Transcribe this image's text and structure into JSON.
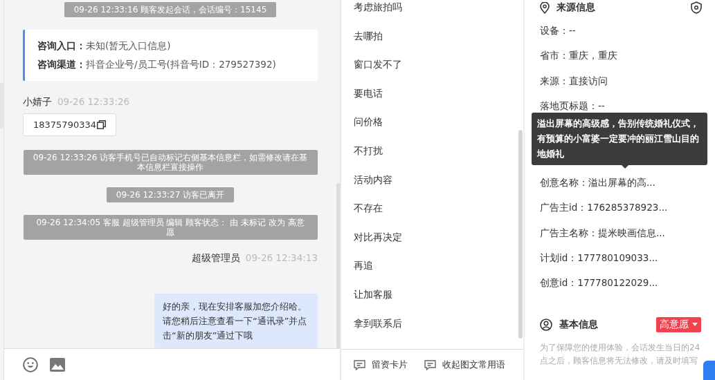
{
  "chat": {
    "messages": [
      {
        "kind": "notice",
        "text": "09-26 12:33:16 顾客发起会话，会话编号：15145"
      },
      {
        "kind": "entry",
        "rows": [
          {
            "label": "咨询入口：",
            "value": "未知(暂无入口信息)"
          },
          {
            "label": "咨询渠道：",
            "value": "抖音企业号/员工号(抖音号ID：279527392)"
          }
        ]
      },
      {
        "kind": "incoming",
        "sender": "小婧子",
        "time": "09-26 12:33:26",
        "text": "18375790334"
      },
      {
        "kind": "notice",
        "text": "09-26 12:33:26 访客手机号已自动标记右侧基本信息栏，如需修改请在基本信息栏直接操作"
      },
      {
        "kind": "notice",
        "text": "09-26 12:33:27 访客已离开"
      },
      {
        "kind": "notice",
        "text": "09-26 12:34:05 客服 超级管理员 编辑 顾客状态： 由 未标记 改为 高意愿"
      },
      {
        "kind": "outgoing",
        "sender": "超级管理员",
        "time": "09-26 12:34:13",
        "text": "好的亲，现在安排客服加您介绍哈。请您稍后注意查看一下“通讯录”并点击“新的朋友”通过下哦"
      }
    ]
  },
  "quick_replies": {
    "items": [
      "考虑旅拍吗",
      "去哪拍",
      "窗口发不了",
      "要电话",
      "问价格",
      "不打扰",
      "活动内容",
      "不存在",
      "对比再决定",
      "再追",
      "让加客服",
      "拿到联系后"
    ],
    "actions": [
      {
        "label": "留资卡片"
      },
      {
        "label": "收起图文常用语"
      }
    ]
  },
  "source_info": {
    "title": "来源信息",
    "fields": [
      {
        "label": "设备：",
        "value": "--"
      },
      {
        "label": "省市：",
        "value": "重庆，重庆"
      },
      {
        "label": "来源：",
        "value": "直接访问"
      },
      {
        "label": "落地页标题：",
        "value": "--"
      },
      {
        "kind": "tooltip",
        "text": "溢出屏幕的高级感，告别传统婚礼仪式，有预算的小富婆一定要冲的丽江雪山目的地婚礼"
      },
      {
        "label": "创意名称：",
        "value": "溢出屏幕的高..."
      },
      {
        "label": "广告主id：",
        "value": "176285378923..."
      },
      {
        "label": "广告主名称：",
        "value": "提米映画信息..."
      },
      {
        "label": "计划id：",
        "value": "177780109033..."
      },
      {
        "label": "创意id：",
        "value": "177780122029..."
      }
    ]
  },
  "basic_info": {
    "title": "基本信息",
    "status": "高意愿",
    "note": "为了保障您的使用体验，会话发生当日的24点之后，顾客信息将无法修改，请及时填写"
  }
}
